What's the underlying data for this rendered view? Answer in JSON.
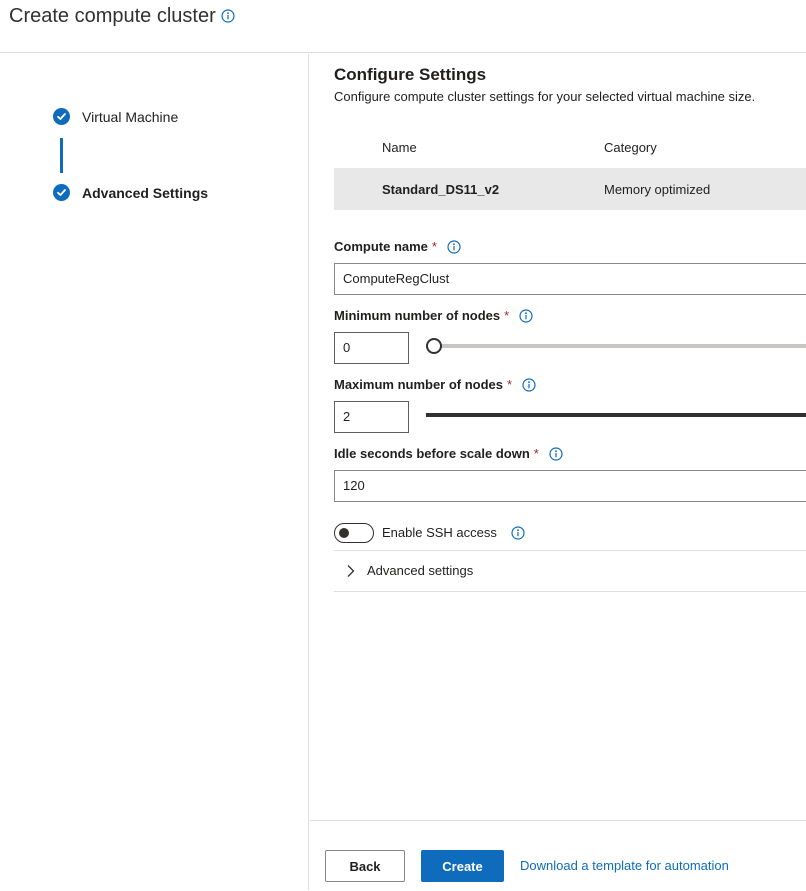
{
  "header": {
    "title": "Create compute cluster"
  },
  "steps": [
    {
      "label": "Virtual Machine",
      "status": "completed"
    },
    {
      "label": "Advanced Settings",
      "status": "current"
    }
  ],
  "section": {
    "title": "Configure Settings",
    "subtitle": "Configure compute cluster settings for your selected virtual machine size."
  },
  "vm_table": {
    "columns": [
      "Name",
      "Category"
    ],
    "rows": [
      {
        "name": "Standard_DS11_v2",
        "category": "Memory optimized"
      }
    ]
  },
  "form": {
    "required_marker": "*",
    "compute_name": {
      "label": "Compute name",
      "value": "ComputeRegClust"
    },
    "min_nodes": {
      "label": "Minimum number of nodes",
      "value": "0",
      "slider_fraction": 0.0
    },
    "max_nodes": {
      "label": "Maximum number of nodes",
      "value": "2",
      "slider_fraction": 1.0
    },
    "idle_seconds": {
      "label": "Idle seconds before scale down",
      "value": "120"
    },
    "ssh": {
      "label": "Enable SSH access",
      "enabled": false
    },
    "advanced": {
      "label": "Advanced settings",
      "expanded": false
    }
  },
  "footer": {
    "back_label": "Back",
    "create_label": "Create",
    "template_link": "Download a template for automation"
  },
  "colors": {
    "accent": "#0f6cbd",
    "required": "#a4262c",
    "table_row_bg": "#e8e8e8"
  },
  "icons": {
    "info": "info-icon",
    "check": "checkmark-icon",
    "expand": "chevron-right-icon"
  }
}
